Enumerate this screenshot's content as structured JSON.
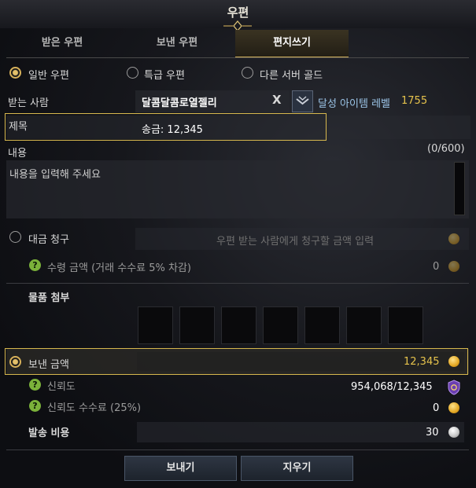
{
  "window": {
    "title": "우편"
  },
  "tabs": [
    {
      "label": "받은 우편"
    },
    {
      "label": "보낸 우편"
    },
    {
      "label": "편지쓰기"
    }
  ],
  "mail_types": [
    {
      "label": "일반 우편",
      "selected": true
    },
    {
      "label": "특급 우편",
      "selected": false
    },
    {
      "label": "다른 서버 골드",
      "selected": false
    }
  ],
  "recipient": {
    "label": "받는 사람",
    "value": "달콤달콤로열젤리",
    "clear": "X",
    "level_label": "달성 아이템 레벨",
    "level_value": "1755"
  },
  "subject": {
    "label": "제목",
    "value": "송금: 12,345"
  },
  "content": {
    "label": "내용",
    "counter": "(0/600)",
    "placeholder": "내용을 입력해 주세요"
  },
  "charge": {
    "label": "대금 청구",
    "placeholder": "우편 받는 사람에게 청구할 금액 입력",
    "receive_label": "수령 금액 (거래 수수료 5% 차감)",
    "receive_value": "0"
  },
  "attach": {
    "label": "물품 첨부",
    "slots": 7
  },
  "send_gold": {
    "label": "보낸 금액",
    "value": "12,345"
  },
  "trust": {
    "label": "신뢰도",
    "value": "954,068/12,345"
  },
  "trust_fee": {
    "label": "신뢰도 수수료 (25%)",
    "value": "0"
  },
  "postage": {
    "label": "발송 비용",
    "value": "30"
  },
  "buttons": {
    "send": "보내기",
    "clear": "지우기"
  },
  "colors": {
    "accent_gold": "#d7b84e",
    "gold_text": "#e6c34c",
    "level_blue": "#9cc5e8"
  }
}
